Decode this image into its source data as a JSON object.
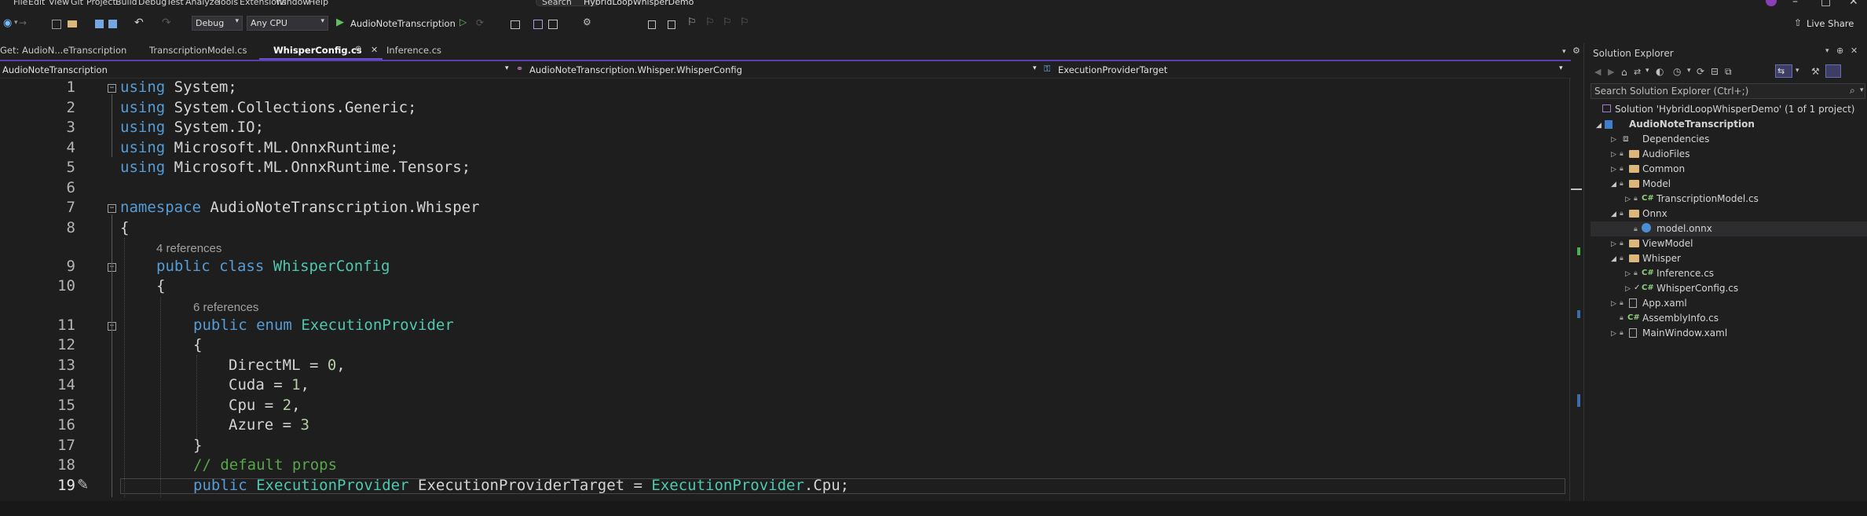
{
  "menu": {
    "items": [
      "File",
      "Edit",
      "View",
      "Git",
      "Project",
      "Build",
      "Debug",
      "Test",
      "Analyze",
      "Tools",
      "Extensions",
      "Window",
      "Help"
    ]
  },
  "title": {
    "search_label": "Search",
    "app_title": "HybridLoopWhisperDemo"
  },
  "toolbar": {
    "config": "Debug",
    "platform": "Any CPU",
    "run_target": "AudioNoteTranscription",
    "live_share": "Live Share"
  },
  "tabs": [
    {
      "label": "Get: AudioN...eTranscription"
    },
    {
      "label": "TranscriptionModel.cs"
    },
    {
      "label": "WhisperConfig.cs"
    },
    {
      "label": "Inference.cs"
    }
  ],
  "navbar": {
    "project": "AudioNoteTranscription",
    "type": "AudioNoteTranscription.Whisper.WhisperConfig",
    "member": "ExecutionProviderTarget"
  },
  "editor": {
    "refs": [
      "4 references",
      "6 references"
    ],
    "lines": {
      "l1": [
        "using",
        " System;"
      ],
      "l2": [
        "using",
        " System.Collections.Generic;"
      ],
      "l3": [
        "using",
        " System.IO;"
      ],
      "l4": [
        "using",
        " Microsoft.ML.OnnxRuntime;"
      ],
      "l5": [
        "using",
        " Microsoft.ML.OnnxRuntime.Tensors;"
      ],
      "l7": [
        "namespace",
        " AudioNoteTranscription.Whisper"
      ],
      "l8": "{",
      "l9": [
        "public",
        " ",
        "class",
        " ",
        "WhisperConfig"
      ],
      "l10": "{",
      "l11": [
        "public",
        " ",
        "enum",
        " ",
        "ExecutionProvider"
      ],
      "l12": "{",
      "l13": [
        "DirectML = ",
        "0",
        ","
      ],
      "l14": [
        "Cuda = ",
        "1",
        ","
      ],
      "l15": [
        "Cpu = ",
        "2",
        ","
      ],
      "l16": [
        "Azure = ",
        "3"
      ],
      "l17": "}",
      "l18": "// default props",
      "l19": [
        "public",
        " ",
        "ExecutionProvider",
        " ExecutionProviderTarget = ",
        "ExecutionProvider",
        ".Cpu;"
      ]
    },
    "line_numbers": [
      "1",
      "2",
      "3",
      "4",
      "5",
      "6",
      "7",
      "8",
      "9",
      "10",
      "11",
      "12",
      "13",
      "14",
      "15",
      "16",
      "17",
      "18",
      "19"
    ]
  },
  "solution_explorer": {
    "title": "Solution Explorer",
    "search_placeholder": "Search Solution Explorer (Ctrl+;)",
    "solution": "Solution 'HybridLoopWhisperDemo' (1 of 1 project)",
    "project": "AudioNoteTranscription",
    "nodes": {
      "dependencies": "Dependencies",
      "audiofiles": "AudioFiles",
      "common": "Common",
      "model": "Model",
      "transcriptionmodel": "TranscriptionModel.cs",
      "onnx": "Onnx",
      "modelonnx": "model.onnx",
      "viewmodel": "ViewModel",
      "whisper": "Whisper",
      "inference": "Inference.cs",
      "whisperconfig": "WhisperConfig.cs",
      "appxaml": "App.xaml",
      "assemblyinfo": "AssemblyInfo.cs",
      "mainwindow": "MainWindow.xaml"
    },
    "cs_badge": "C#"
  }
}
